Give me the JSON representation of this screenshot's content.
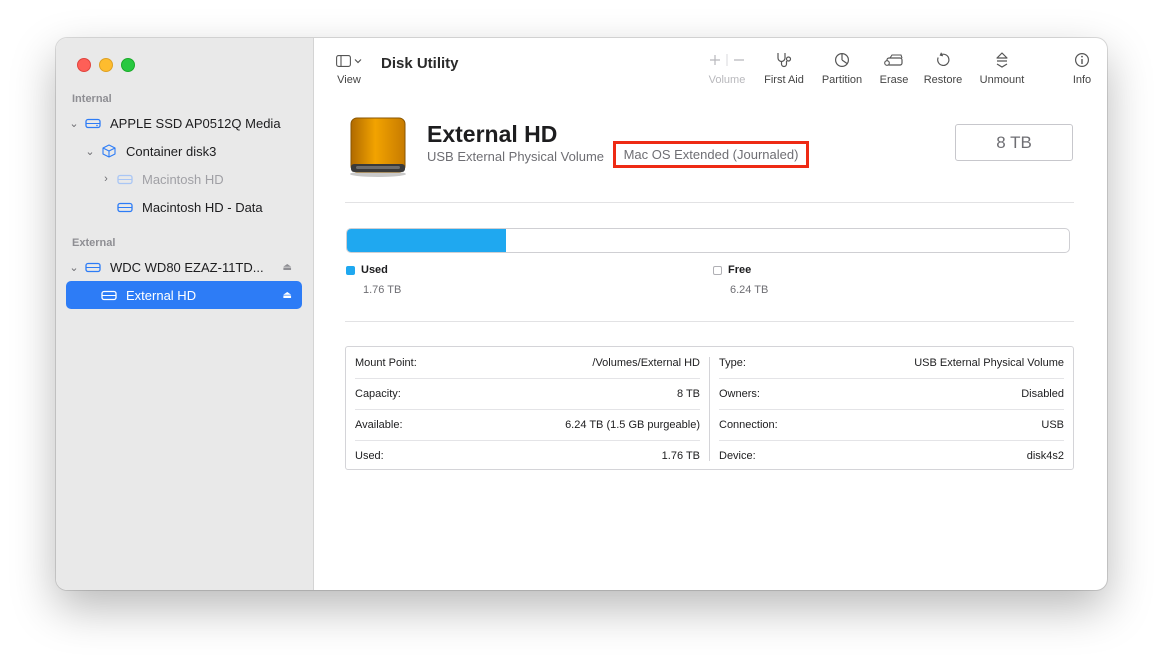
{
  "window": {
    "title": "Disk Utility"
  },
  "sidebar": {
    "sections": [
      {
        "label": "Internal"
      },
      {
        "label": "External"
      }
    ],
    "items": [
      {
        "label": "APPLE SSD AP0512Q Media"
      },
      {
        "label": "Container disk3"
      },
      {
        "label": "Macintosh HD"
      },
      {
        "label": "Macintosh HD - Data"
      },
      {
        "label": "WDC WD80 EZAZ-11TD..."
      },
      {
        "label": "External HD"
      }
    ]
  },
  "toolbar": {
    "view_label": "View",
    "buttons": [
      {
        "label": "Volume",
        "icon": "plus-minus-icon"
      },
      {
        "label": "First Aid",
        "icon": "stethoscope-icon"
      },
      {
        "label": "Partition",
        "icon": "pie-icon"
      },
      {
        "label": "Erase",
        "icon": "erase-drive-icon"
      },
      {
        "label": "Restore",
        "icon": "restore-icon"
      },
      {
        "label": "Unmount",
        "icon": "unmount-icon"
      },
      {
        "label": "Info",
        "icon": "info-icon"
      }
    ]
  },
  "disk": {
    "name": "External HD",
    "type": "USB External Physical Volume",
    "format": "Mac OS Extended (Journaled)",
    "size": "8 TB",
    "used_fraction": 0.22
  },
  "usage": {
    "used_label": "Used",
    "used_value": "1.76 TB",
    "free_label": "Free",
    "free_value": "6.24 TB",
    "used_color": "#1fa8f0"
  },
  "info": {
    "left": [
      {
        "key": "Mount Point:",
        "value": "/Volumes/External HD"
      },
      {
        "key": "Capacity:",
        "value": "8 TB"
      },
      {
        "key": "Available:",
        "value": "6.24 TB (1.5 GB purgeable)"
      },
      {
        "key": "Used:",
        "value": "1.76 TB"
      }
    ],
    "right": [
      {
        "key": "Type:",
        "value": "USB External Physical Volume"
      },
      {
        "key": "Owners:",
        "value": "Disabled"
      },
      {
        "key": "Connection:",
        "value": "USB"
      },
      {
        "key": "Device:",
        "value": "disk4s2"
      }
    ]
  },
  "colors": {
    "accent": "#2d7cf6",
    "highlight_border": "#ee2a14"
  }
}
